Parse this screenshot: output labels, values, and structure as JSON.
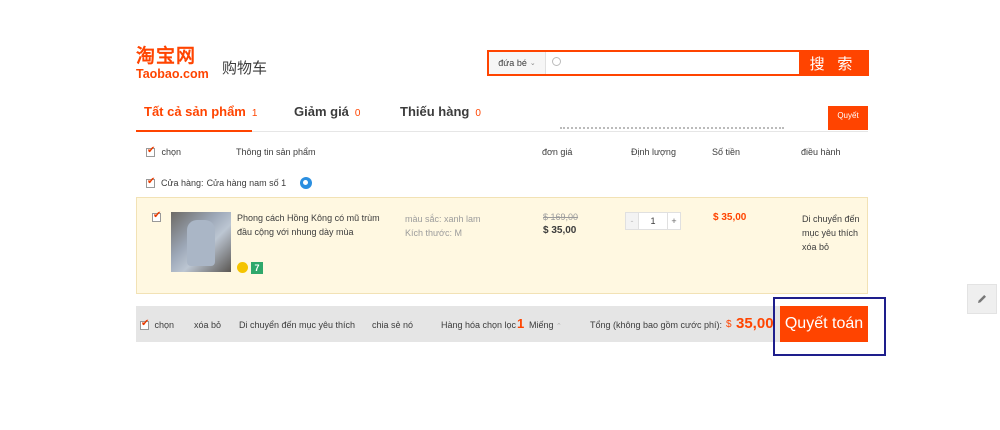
{
  "header": {
    "logo_cn": "淘宝网",
    "logo_en": "Taobao.com",
    "title": "购物车"
  },
  "search": {
    "category": "đứa bé",
    "placeholder": "",
    "button": "搜 索"
  },
  "tabs": [
    {
      "label": "Tất cả sản phẩm",
      "count": "1"
    },
    {
      "label": "Giảm giá",
      "count": "0"
    },
    {
      "label": "Thiếu hàng",
      "count": "0"
    }
  ],
  "tab_checkout": "Quyết",
  "columns": {
    "select": "chọn",
    "info": "Thông tin sản phẩm",
    "unit_price": "đơn giá",
    "quantity": "Định lượng",
    "amount": "Số tiền",
    "actions": "điều hành"
  },
  "shop": {
    "label": "Cửa hàng:",
    "name": "Cửa hàng nam số 1"
  },
  "item": {
    "name": "Phong cách Hồng Kông có mũ trùm đầu cộng với nhung dày mùa",
    "color": "màu sắc: xanh lam",
    "size": "Kích thước: M",
    "price_old": "$ 169,00",
    "price_new": "$ 35,00",
    "quantity": "1",
    "subtotal": "$ 35,00",
    "action_move": "Di chuyển đến mục yêu thích",
    "action_delete": "xóa bỏ",
    "badge_number": "7"
  },
  "footer": {
    "select": "chọn",
    "delete": "xóa bỏ",
    "move": "Di chuyển đến mục yêu thích",
    "share": "chia sẻ nó",
    "selected_label": "Hàng hóa chọn lọc",
    "selected_count": "1",
    "unit": "Miếng",
    "total_label": "Tổng (không bao gồm cước phí):",
    "currency": "$",
    "total_value": "35,00",
    "checkout": "Quyết toán"
  },
  "colors": {
    "accent": "#ff4400",
    "highlight_frame": "#1e1e8c",
    "item_bg": "#fff8e1"
  }
}
